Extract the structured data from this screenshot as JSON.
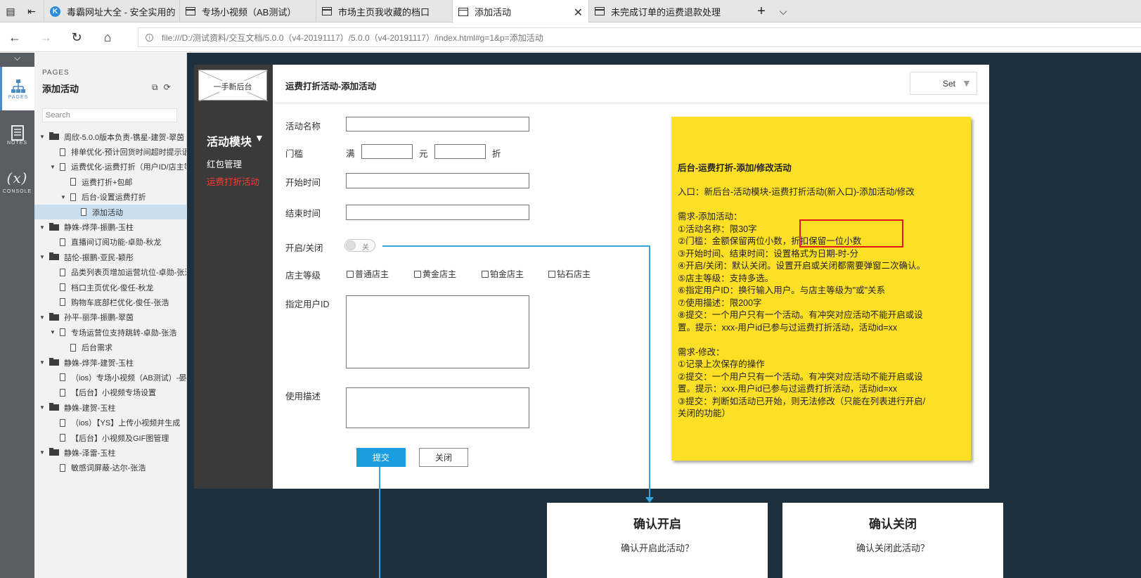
{
  "browser": {
    "tabs": [
      {
        "title": "毒霸网址大全 - 安全实用的",
        "icon": "k-logo-icon"
      },
      {
        "title": "专场小视频（AB测试）",
        "icon": "page-icon"
      },
      {
        "title": "市场主页我收藏的档口",
        "icon": "page-icon"
      },
      {
        "title": "添加活动",
        "icon": "page-icon",
        "active": true
      },
      {
        "title": "未完成订单的运费退款处理",
        "icon": "page-icon"
      }
    ],
    "new_tab": "+",
    "tab_menu": "⌵",
    "url": "file:///D:/测试资料/交互文档/5.0.0（v4-20191117）/5.0.0（v4-20191117）/index.html#g=1&p=添加活动",
    "back": "←",
    "forward": "→",
    "reload": "↻",
    "home": "⌂",
    "info": "i"
  },
  "strip": {
    "collapse": "⌵",
    "pages": {
      "label": "PAGES"
    },
    "notes": {
      "label": "NOTES"
    },
    "console": {
      "label": "CONSOLE",
      "glyph": "(x)"
    }
  },
  "pages_panel": {
    "heading": "PAGES",
    "current": "添加活动",
    "search_placeholder": "Search",
    "tree": [
      {
        "text": "周欣-5.0.0版本负责-镌星-建贺-翠茵",
        "kind": "folder",
        "level": 0,
        "expanded": true
      },
      {
        "text": "排单优化-预计回货时间超时提示语",
        "kind": "page",
        "level": 1
      },
      {
        "text": "运费优化-运费打折（用户ID/店主等级）",
        "kind": "page",
        "level": 1,
        "expanded": true
      },
      {
        "text": "运费打折+包邮",
        "kind": "page",
        "level": 2
      },
      {
        "text": "后台-设置运费打折",
        "kind": "page",
        "level": 2,
        "expanded": true
      },
      {
        "text": "添加活动",
        "kind": "page",
        "level": 3,
        "selected": true
      },
      {
        "text": "静姝-烨萍-振鹏-玉柱",
        "kind": "folder",
        "level": 0,
        "expanded": true
      },
      {
        "text": "直播间订阅功能-卓勋-秋龙",
        "kind": "page",
        "level": 1
      },
      {
        "text": "喆伦-振鹏-亚民-颖彤",
        "kind": "folder",
        "level": 0,
        "expanded": true
      },
      {
        "text": "品类列表页增加运营坑位-卓勋-张浩",
        "kind": "page",
        "level": 1
      },
      {
        "text": "档口主页优化-俊任-秋龙",
        "kind": "page",
        "level": 1
      },
      {
        "text": "购物车底部栏优化-俊任-张浩",
        "kind": "page",
        "level": 1
      },
      {
        "text": "孙平-丽萍-振鹏-翠茵",
        "kind": "folder",
        "level": 0,
        "expanded": true
      },
      {
        "text": "专场运营位支持跳转-卓勋-张浩",
        "kind": "page",
        "level": 1,
        "expanded": true
      },
      {
        "text": "后台需求",
        "kind": "page",
        "level": 2
      },
      {
        "text": "静姝-烨萍-建贺-玉柱",
        "kind": "folder",
        "level": 0,
        "expanded": true
      },
      {
        "text": "（ios）专场小视频（AB测试）-晏",
        "kind": "page",
        "level": 1
      },
      {
        "text": "【后台】小视频专场设置",
        "kind": "page",
        "level": 1
      },
      {
        "text": "静姝-建贺-玉柱",
        "kind": "folder",
        "level": 0,
        "expanded": true
      },
      {
        "text": "（ios）【YS】上传小视频并生成",
        "kind": "page",
        "level": 1
      },
      {
        "text": "【后台】小视频及GIF图管理",
        "kind": "page",
        "level": 1
      },
      {
        "text": "静姝-泽雷-玉柱",
        "kind": "folder",
        "level": 0,
        "expanded": true
      },
      {
        "text": "敏感词屏蔽-达尔-张浩",
        "kind": "page",
        "level": 1
      }
    ]
  },
  "app": {
    "logo_text": "一手新后台",
    "module_title": "活动模块",
    "module_arrow": "▼",
    "side_links": [
      "红包管理",
      "运费打折活动"
    ],
    "form_title": "运费打折活动-添加活动",
    "set_label": "Set",
    "set_arrow": "▼",
    "fields": {
      "name": {
        "label": "活动名称",
        "value": ""
      },
      "threshold": {
        "label": "门槛",
        "prefix": "满",
        "unit": "元",
        "suffix": "折",
        "amount": "",
        "discount": ""
      },
      "start": {
        "label": "开始时间",
        "value": ""
      },
      "end": {
        "label": "结束时间",
        "value": ""
      },
      "toggle": {
        "label": "开启/关闭",
        "state": "关"
      },
      "level": {
        "label": "店主等级",
        "options": [
          "普通店主",
          "黄金店主",
          "铂金店主",
          "钻石店主"
        ]
      },
      "user_id": {
        "label": "指定用户ID",
        "value": ""
      },
      "desc": {
        "label": "使用描述",
        "value": ""
      }
    },
    "submit_label": "提交",
    "close_label": "关闭"
  },
  "note": {
    "title": "后台-运费打折-添加/修改活动",
    "lines": [
      "入口：新后台-活动模块-运费打折活动(新入口)-添加活动/修改",
      "",
      "需求-添加活动：",
      "①活动名称：限30字",
      "②门槛：金额保留两位小数，折扣保留一位小数",
      "③开始时间、结束时间：设置格式为日期-时-分",
      "④开启/关闭：默认关闭。设置开启或关闭都需要弹窗二次确认。",
      "⑤店主等级：支持多选。",
      "⑥指定用户ID：换行输入用户。与店主等级为\"或\"关系",
      "⑦使用描述：限200字",
      "⑧提交：一个用户只有一个活动。有冲突对应活动不能开启或设",
      "置。提示：xxx-用户id已参与过运费打折活动，活动id=xx",
      "",
      "需求-修改：",
      "①记录上次保存的操作",
      "②提交：一个用户只有一个活动。有冲突对应活动不能开启或设",
      "置。提示：xxx-用户id已参与过运费打折活动，活动id=xx",
      "③提交：判断如活动已开始，则无法修改（只能在列表进行开启/",
      "关闭的功能）"
    ]
  },
  "dialogs": [
    {
      "title": "确认开启",
      "body": "确认开启此活动？"
    },
    {
      "title": "确认关闭",
      "body": "确认关闭此活动？"
    }
  ],
  "colors": {
    "accent": "#1a9ee0",
    "sticky": "#fde025",
    "active_link": "#ff3b30",
    "canvas_bg": "#1e2f3e",
    "connector": "#35a6dd"
  }
}
